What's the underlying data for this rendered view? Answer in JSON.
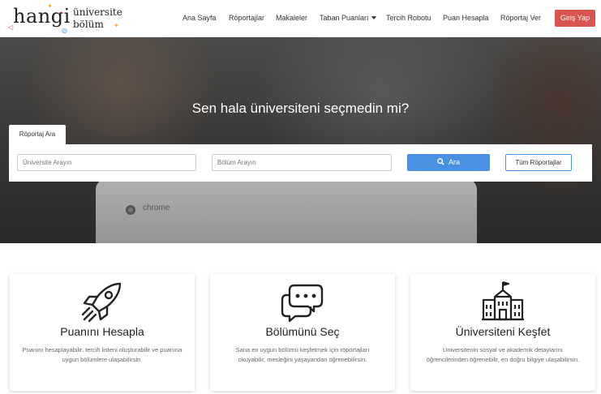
{
  "header": {
    "logo": {
      "word": "hangi",
      "line1": "üniversite",
      "line2": "bölüm"
    },
    "nav": [
      {
        "label": "Ana Sayfa"
      },
      {
        "label": "Röportajlar"
      },
      {
        "label": "Makaleler"
      },
      {
        "label": "Taban Puanları",
        "dropdown": true
      },
      {
        "label": "Tercih Robotu"
      },
      {
        "label": "Puan Hesapla"
      },
      {
        "label": "Röportaj Ver"
      }
    ],
    "login_label": "Giriş Yap",
    "colors": {
      "login_bg": "#d9534f",
      "accent": "#4a90e2"
    }
  },
  "hero": {
    "title": "Sen hala üniversiteni seçmedin mi?",
    "tab_label": "Röportaj Ara",
    "search": {
      "university_placeholder": "Üniversite Arayın",
      "department_placeholder": "Bölüm Arayın",
      "search_label": "Ara",
      "all_label": "Tüm Röportajlar"
    },
    "background_text": "chrome"
  },
  "cards": [
    {
      "icon": "rocket-icon",
      "title": "Puanını Hesapla",
      "desc": "Puanını hesaplayabilir, tercih listeni oluşturabilir ve puanına uygun bölümlere ulaşabilirsin."
    },
    {
      "icon": "chat-bubbles-icon",
      "title": "Bölümünü Seç",
      "desc": "Sana en uygun bölümü keşfetmek için röportajları okuyabilir, mesleğini yaşayandan öğrenebilirsin."
    },
    {
      "icon": "university-building-icon",
      "title": "Üniversiteni Keşfet",
      "desc": "Üniversitenin sosyal ve akademik detaylarını öğrencilerinden öğrenebilir, en doğru bilgiye ulaşabilirsin."
    }
  ]
}
